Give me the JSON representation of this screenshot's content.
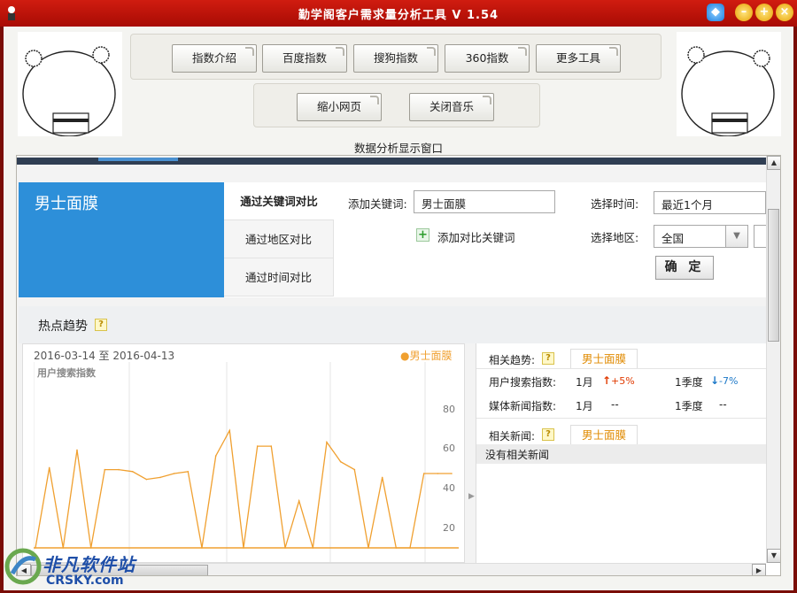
{
  "window": {
    "title": "勤学阁客户需求量分析工具 V 1.54"
  },
  "toolbar": {
    "row1": [
      "指数介绍",
      "百度指数",
      "搜狗指数",
      "360指数",
      "更多工具"
    ],
    "row2": [
      "缩小网页",
      "关闭音乐"
    ]
  },
  "section_title": "数据分析显示窗口",
  "keyword_panel": {
    "title": "男士面膜"
  },
  "tabs": [
    "通过关键词对比",
    "通过地区对比",
    "通过时间对比"
  ],
  "form": {
    "add_keyword_label": "添加关键词:",
    "keyword_value": "男士面膜",
    "add_compare_label": "添加对比关键词",
    "time_label": "选择时间:",
    "time_value": "最近1个月",
    "region_label": "选择地区:",
    "region_value": "全国",
    "confirm_label": "确 定"
  },
  "hot": {
    "title": "热点趋势",
    "help": "?"
  },
  "chart": {
    "date_range": "2016-03-14 至 2016-04-13",
    "legend": "●男士面膜",
    "ylabel": "用户搜索指数",
    "yticks": [
      "80",
      "60",
      "40",
      "20"
    ]
  },
  "chart_data": {
    "type": "line",
    "title": "",
    "xlabel": "",
    "ylabel": "用户搜索指数",
    "ylim": [
      0,
      95
    ],
    "x": [
      1,
      2,
      3,
      4,
      5,
      6,
      7,
      8,
      9,
      10,
      11,
      12,
      13,
      14,
      15,
      16,
      17,
      18,
      19,
      20,
      21,
      22,
      23,
      24,
      25,
      26,
      27,
      28,
      29,
      30,
      31
    ],
    "series": [
      {
        "name": "男士面膜",
        "color": "#f0a030",
        "values": [
          0,
          41,
          0,
          50,
          0,
          40,
          40,
          39,
          35,
          36,
          38,
          39,
          0,
          47,
          60,
          0,
          52,
          52,
          0,
          24,
          0,
          54,
          44,
          40,
          0,
          36,
          0,
          0,
          38,
          38,
          38
        ]
      }
    ]
  },
  "related": {
    "trend_label": "相关趋势:",
    "trend_tab": "男士面膜",
    "rows": [
      {
        "label": "用户搜索指数:",
        "m_label": "1月",
        "m_value": "+5%",
        "q_label": "1季度",
        "q_value": "-7%"
      },
      {
        "label": "媒体新闻指数:",
        "m_label": "1月",
        "m_value": "--",
        "q_label": "1季度",
        "q_value": "--"
      }
    ],
    "news_label": "相关新闻:",
    "news_tab": "男士面膜",
    "no_news": "没有相关新闻"
  },
  "watermark": {
    "cn": "非凡软件站",
    "en": "CRSKY.com"
  }
}
